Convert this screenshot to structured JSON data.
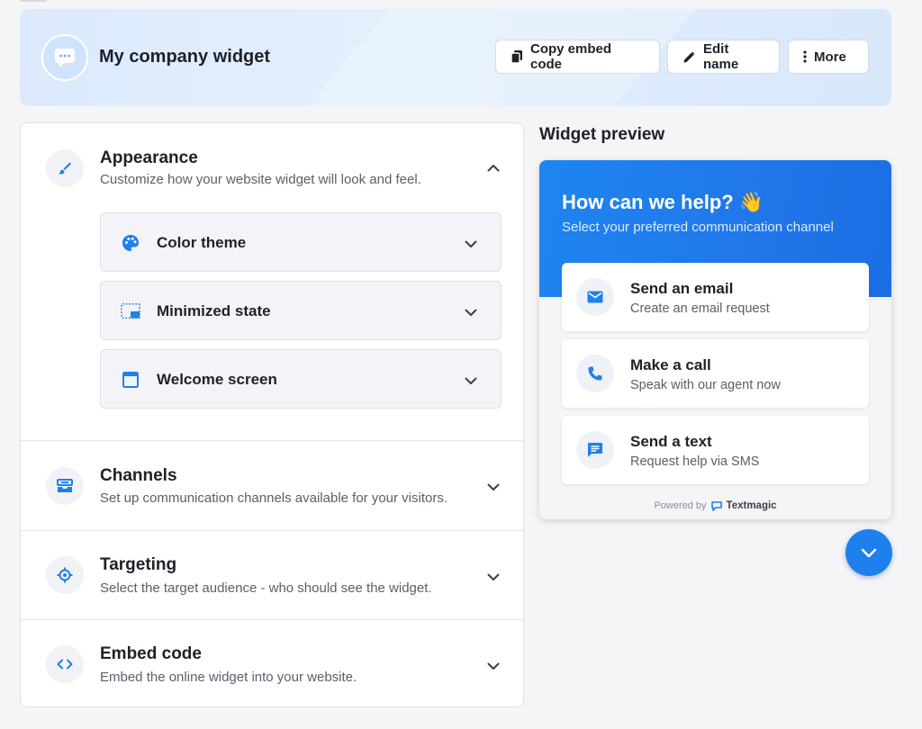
{
  "header": {
    "title": "My company widget",
    "buttons": {
      "copy": "Copy embed code",
      "edit": "Edit name",
      "more": "More"
    }
  },
  "settings": {
    "sections": [
      {
        "title": "Appearance",
        "description": "Customize how your website widget will look and feel.",
        "expanded": true,
        "icon": "brush-icon",
        "items": [
          {
            "label": "Color theme",
            "icon": "palette-icon"
          },
          {
            "label": "Minimized state",
            "icon": "minimize-icon"
          },
          {
            "label": "Welcome screen",
            "icon": "window-icon"
          }
        ]
      },
      {
        "title": "Channels",
        "description": "Set up communication channels available for your visitors.",
        "expanded": false,
        "icon": "inbox-icon"
      },
      {
        "title": "Targeting",
        "description": "Select the target audience - who should see the widget.",
        "expanded": false,
        "icon": "target-icon"
      },
      {
        "title": "Embed code",
        "description": "Embed the online widget into your website.",
        "expanded": false,
        "icon": "code-icon"
      }
    ]
  },
  "preview": {
    "title": "Widget preview",
    "heading": "How can we help? 👋",
    "subheading": "Select your preferred communication channel",
    "channels": [
      {
        "title": "Send an email",
        "description": "Create an email request",
        "icon": "mail-icon"
      },
      {
        "title": "Make a call",
        "description": "Speak with our agent now",
        "icon": "phone-icon"
      },
      {
        "title": "Send a text",
        "description": "Request help via SMS",
        "icon": "sms-icon"
      }
    ],
    "powered_by": "Powered by",
    "brand": "Textmagic"
  },
  "colors": {
    "accent": "#1e80ec",
    "header_bg": "#dbeafb",
    "panel_bg": "#ffffff",
    "text": "#1f2129",
    "muted": "#5b5f6b"
  }
}
